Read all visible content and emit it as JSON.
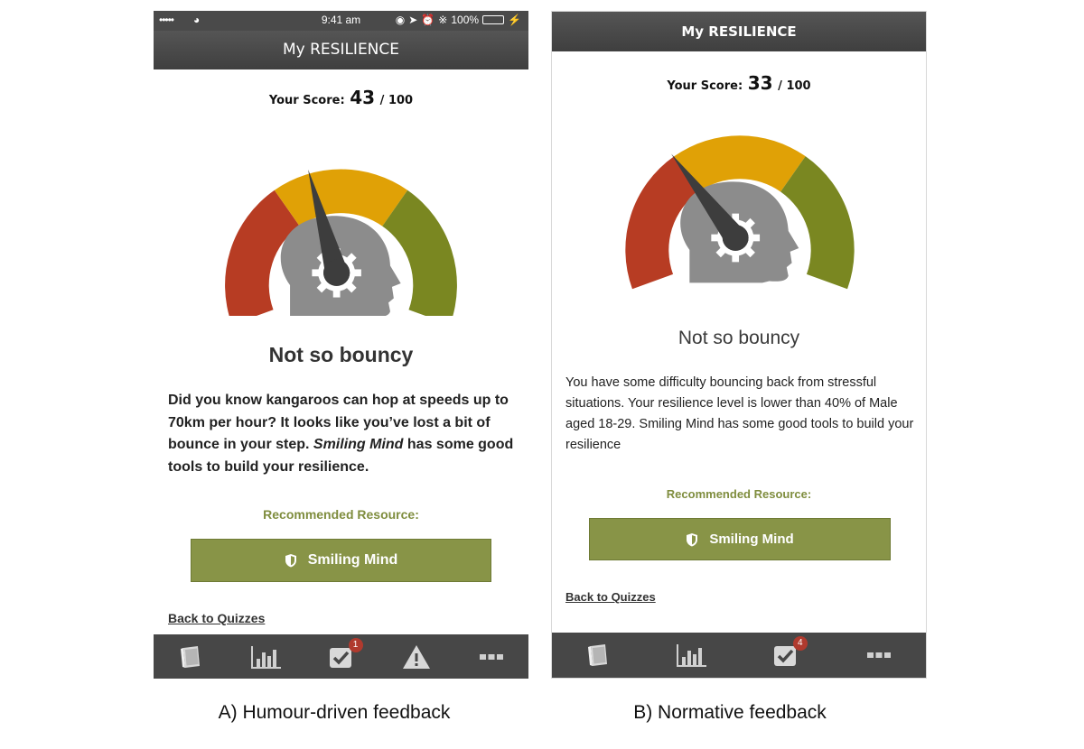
{
  "colors": {
    "navbar": "#4a4a4a",
    "gauge_red": "#b73c23",
    "gauge_yellow": "#e0a106",
    "gauge_green": "#7a8721",
    "head": "#8c8c8c",
    "needle": "#3d3d3d",
    "accent_olive": "#889447",
    "badge_red": "#b03a2e"
  },
  "panel_a": {
    "status": {
      "signal": "•••••",
      "time": "9:41 am",
      "battery": "100%"
    },
    "title": "My RESILIENCE",
    "score": {
      "label": "Your Score:",
      "value": "43",
      "max": "/ 100"
    },
    "gauge_score": 43,
    "headline": "Not so bouncy",
    "body_pre": "Did you know kangaroos can hop at speeds up to 70km per hour? It looks like you’ve lost a bit of bounce in your step. ",
    "body_emph": "Smiling Mind",
    "body_post": " has some good tools to build your resilience.",
    "recommended_label": "Recommended Resource:",
    "resource_button": "Smiling Mind",
    "back_link": "Back to Quizzes",
    "tabs": [
      {
        "icon": "book-icon"
      },
      {
        "icon": "bar-chart-icon"
      },
      {
        "icon": "checkbox-icon",
        "badge": "1"
      },
      {
        "icon": "warning-icon"
      },
      {
        "icon": "more-icon"
      }
    ]
  },
  "panel_b": {
    "title": "My RESILIENCE",
    "score": {
      "label": "Your Score:",
      "value": "33",
      "max": "/ 100"
    },
    "gauge_score": 33,
    "headline": "Not so bouncy",
    "body": "You have some difficulty bouncing back from stressful situations. Your resilience level is lower than 40% of Male aged 18-29. Smiling Mind has some good tools to build your resilience",
    "recommended_label": "Recommended Resource:",
    "resource_button": "Smiling Mind",
    "back_link": "Back to Quizzes",
    "tabs": [
      {
        "icon": "book-icon"
      },
      {
        "icon": "bar-chart-icon"
      },
      {
        "icon": "checkbox-icon",
        "badge": "4"
      },
      {
        "icon": "more-icon"
      }
    ]
  },
  "captions": {
    "a": "A) Humour-driven feedback",
    "b": "B) Normative feedback"
  }
}
